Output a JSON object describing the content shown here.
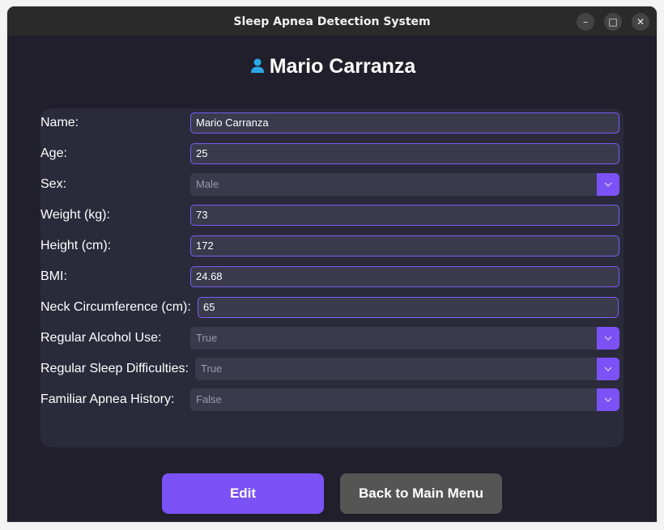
{
  "window": {
    "title": "Sleep Apnea Detection System",
    "minimize_glyph": "–",
    "maximize_glyph": "□",
    "close_glyph": "✕"
  },
  "header": {
    "icon": "person-icon",
    "name": "Mario Carranza"
  },
  "form": {
    "name": {
      "label": "Name:",
      "value": "Mario Carranza"
    },
    "age": {
      "label": "Age:",
      "value": "25"
    },
    "sex": {
      "label": "Sex:",
      "value": "Male"
    },
    "weight": {
      "label": "Weight (kg):",
      "value": "73"
    },
    "height": {
      "label": "Height (cm):",
      "value": "172"
    },
    "bmi": {
      "label": "BMI:",
      "value": "24.68"
    },
    "neck": {
      "label": "Neck Circumference (cm):",
      "value": "65"
    },
    "alcohol": {
      "label": "Regular Alcohol Use:",
      "value": "True"
    },
    "sleep": {
      "label": "Regular Sleep Difficulties:",
      "value": "True"
    },
    "apnea": {
      "label": "Familiar Apnea History:",
      "value": "False"
    }
  },
  "buttons": {
    "edit_label": "Edit",
    "back_label": "Back to Main Menu"
  },
  "colors": {
    "accent": "#7b52f5",
    "background": "#201f2b",
    "panel": "#2b2a3a",
    "secondary_button": "#555555"
  }
}
